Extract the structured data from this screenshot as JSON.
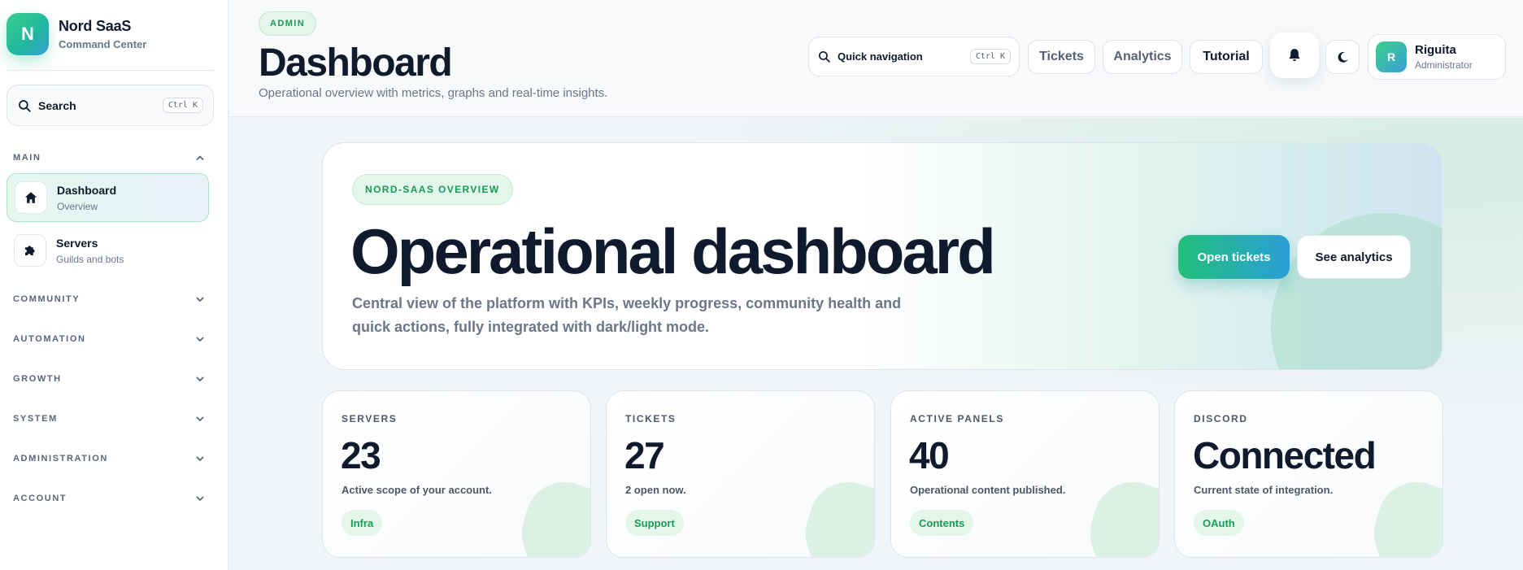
{
  "brand": {
    "logo_letter": "N",
    "name": "Nord SaaS",
    "subtitle": "Command Center"
  },
  "sidebar": {
    "search": {
      "label": "Search",
      "shortcut": "Ctrl K"
    },
    "main_section": "MAIN",
    "items": [
      {
        "title": "Dashboard",
        "subtitle": "Overview",
        "icon": "home-icon",
        "active": true
      },
      {
        "title": "Servers",
        "subtitle": "Guilds and bots",
        "icon": "puzzle-icon",
        "active": false
      }
    ],
    "sections": [
      "COMMUNITY",
      "AUTOMATION",
      "GROWTH",
      "SYSTEM",
      "ADMINISTRATION",
      "ACCOUNT"
    ]
  },
  "header": {
    "badge": "ADMIN",
    "title": "Dashboard",
    "subtitle": "Operational overview with metrics, graphs and real-time insights.",
    "quick_nav": {
      "label": "Quick navigation",
      "shortcut": "Ctrl K"
    },
    "buttons": {
      "tickets": "Tickets",
      "analytics": "Analytics",
      "tutorial": "Tutorial"
    },
    "icons": {
      "bell": "bell-icon",
      "theme": "moon-icon"
    },
    "user": {
      "initial": "R",
      "name": "Riguita",
      "role": "Administrator"
    }
  },
  "hero": {
    "badge": "NORD-SAAS OVERVIEW",
    "title": "Operational dashboard",
    "description": "Central view of the platform with KPIs, weekly progress, community health and quick actions, fully integrated with dark/light mode.",
    "primary_button": "Open tickets",
    "secondary_button": "See analytics"
  },
  "stats": [
    {
      "label": "SERVERS",
      "value": "23",
      "description": "Active scope of your account.",
      "tag": "Infra"
    },
    {
      "label": "TICKETS",
      "value": "27",
      "description": "2 open now.",
      "tag": "Support"
    },
    {
      "label": "ACTIVE PANELS",
      "value": "40",
      "description": "Operational content published.",
      "tag": "Contents"
    },
    {
      "label": "DISCORD",
      "value": "Connected",
      "description": "Current state of integration.",
      "tag": "OAuth"
    }
  ],
  "colors": {
    "accent_green": "#1a9a57",
    "gradient_start": "#22c07a",
    "gradient_end": "#2b9ed8",
    "text_dark": "#0f1b2d",
    "text_muted": "#6b7789"
  }
}
